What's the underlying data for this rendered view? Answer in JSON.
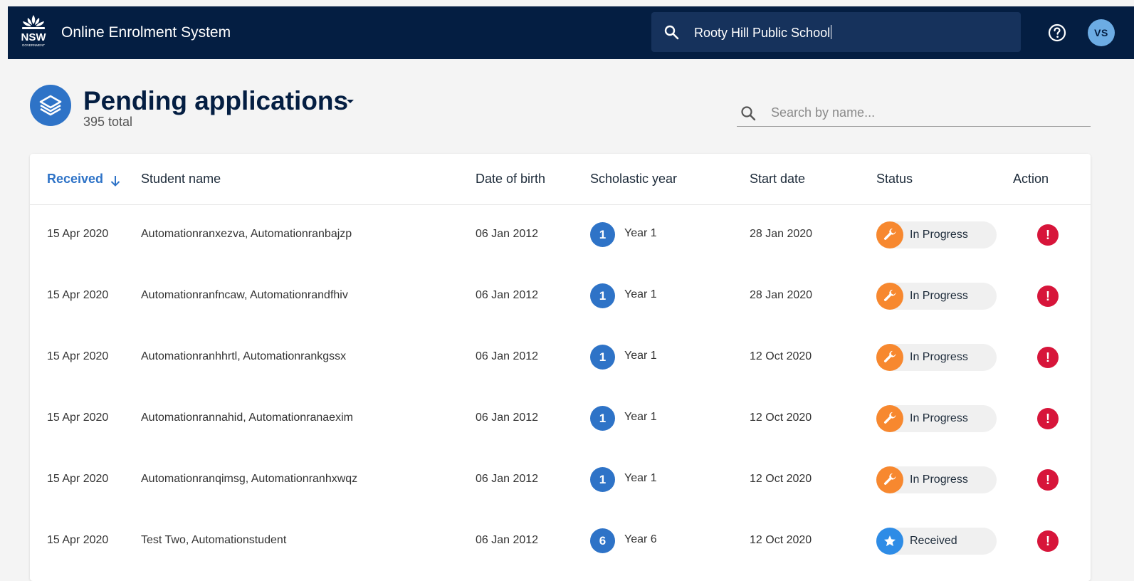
{
  "app": {
    "title": "Online Enrolment System",
    "logo_text": "NSW",
    "logo_subtext": "GOVERNMENT"
  },
  "topbar": {
    "school_search_value": "Rooty Hill Public School",
    "user_initials": "VS",
    "icons": {
      "search": "search-icon",
      "help": "help-icon"
    },
    "colors": {
      "background": "#041e42",
      "search_bg": "#16325c",
      "avatar": "#6cace4"
    }
  },
  "page": {
    "title": "Pending applications",
    "total": "395 total",
    "name_search_placeholder": "Search by name...",
    "icon": "layers-icon"
  },
  "table": {
    "columns": {
      "received": "Received",
      "student_name": "Student name",
      "dob": "Date of birth",
      "scholastic_year": "Scholastic year",
      "start_date": "Start date",
      "status": "Status",
      "action": "Action"
    },
    "sort": {
      "column": "Received",
      "direction": "descending"
    },
    "rows": [
      {
        "received": "15 Apr 2020",
        "name": "Automationranxezva, Automationranbajzp",
        "dob": "06 Jan 2012",
        "year_num": "1",
        "year_label": "Year 1",
        "start": "28 Jan 2020",
        "status": "In Progress",
        "status_kind": "in-progress"
      },
      {
        "received": "15 Apr 2020",
        "name": "Automationranfncaw, Automationrandfhiv",
        "dob": "06 Jan 2012",
        "year_num": "1",
        "year_label": "Year 1",
        "start": "28 Jan 2020",
        "status": "In Progress",
        "status_kind": "in-progress"
      },
      {
        "received": "15 Apr 2020",
        "name": "Automationranhhrtl, Automationrankgssx",
        "dob": "06 Jan 2012",
        "year_num": "1",
        "year_label": "Year 1",
        "start": "12 Oct 2020",
        "status": "In Progress",
        "status_kind": "in-progress"
      },
      {
        "received": "15 Apr 2020",
        "name": "Automationrannahid, Automationranaexim",
        "dob": "06 Jan 2012",
        "year_num": "1",
        "year_label": "Year 1",
        "start": "12 Oct 2020",
        "status": "In Progress",
        "status_kind": "in-progress"
      },
      {
        "received": "15 Apr 2020",
        "name": "Automationranqimsg, Automationranhxwqz",
        "dob": "06 Jan 2012",
        "year_num": "1",
        "year_label": "Year 1",
        "start": "12 Oct 2020",
        "status": "In Progress",
        "status_kind": "in-progress"
      },
      {
        "received": "15 Apr 2020",
        "name": "Test Two, Automationstudent",
        "dob": "06 Jan 2012",
        "year_num": "6",
        "year_label": "Year 6",
        "start": "12 Oct 2020",
        "status": "Received",
        "status_kind": "received"
      }
    ]
  },
  "colors": {
    "accent_blue": "#2e73c7",
    "in_progress": "#f7882f",
    "received": "#2e8ce6",
    "alert": "#d7153a"
  }
}
